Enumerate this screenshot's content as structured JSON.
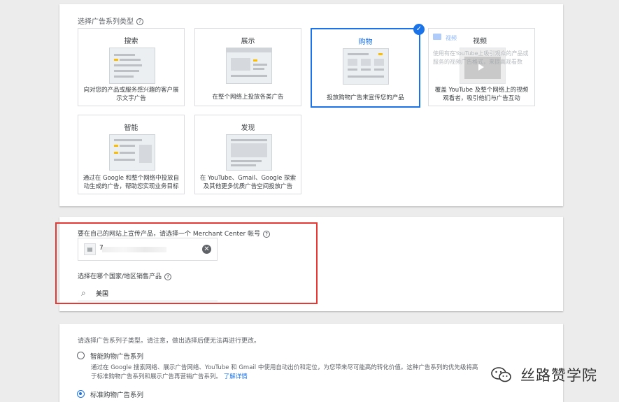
{
  "campaign_type": {
    "label": "选择广告系列类型",
    "tiles": [
      {
        "title": "搜索",
        "desc": "向对您的产品或服务感兴趣的客户展示文字广告",
        "selected": false
      },
      {
        "title": "展示",
        "desc": "在整个网络上投放各类广告",
        "selected": false
      },
      {
        "title": "购物",
        "desc": "投放购物广告来宣传您的产品",
        "selected": true
      },
      {
        "title": "视频",
        "desc": "覆盖 YouTube 及整个网络上的视频观看者，吸引他们与广告互动",
        "selected": false,
        "overlay_chip": "视频",
        "overlay_text": "使用有在YouTube上吸引观众的产品或服务的视频广告格式，来提高观看数"
      },
      {
        "title": "智能",
        "desc": "通过在 Google 和整个网络中投放自动生成的广告，帮助您实现业务目标",
        "selected": false
      },
      {
        "title": "发现",
        "desc": "在 YouTube、Gmail、Google 探索及其他更多优质广告空间投放广告",
        "selected": false
      }
    ],
    "check_glyph": "✓"
  },
  "merchant": {
    "account_label": "要在自己的网站上宣传产品，请选择一个 Merchant Center 帐号",
    "account_value": "7",
    "clear_glyph": "✕",
    "country_label": "选择在哪个国家/地区销售产品",
    "country_value": "美国",
    "search_glyph": "⌕",
    "help_glyph": "?"
  },
  "subtype": {
    "label": "请选择广告系列子类型。请注意，做出选择后便无法再进行更改。",
    "options": [
      {
        "label": "智能购物广告系列",
        "selected": false
      },
      {
        "label": "标准购物广告系列",
        "selected": true
      }
    ],
    "desc": "通过在 Google 搜索网络、展示广告网络、YouTube 和 Gmail 中使用自动出价和定位，为您带来尽可能高的转化价值。这种广告系列的优先级将高于标准购物广告系列和展示广告再营销广告系列。",
    "link": "了解详情"
  },
  "watermark": {
    "text": "丝路赞学院"
  },
  "colors": {
    "accent": "#1a73e8",
    "highlight": "#e53935",
    "yellow": "#fbbc04"
  }
}
